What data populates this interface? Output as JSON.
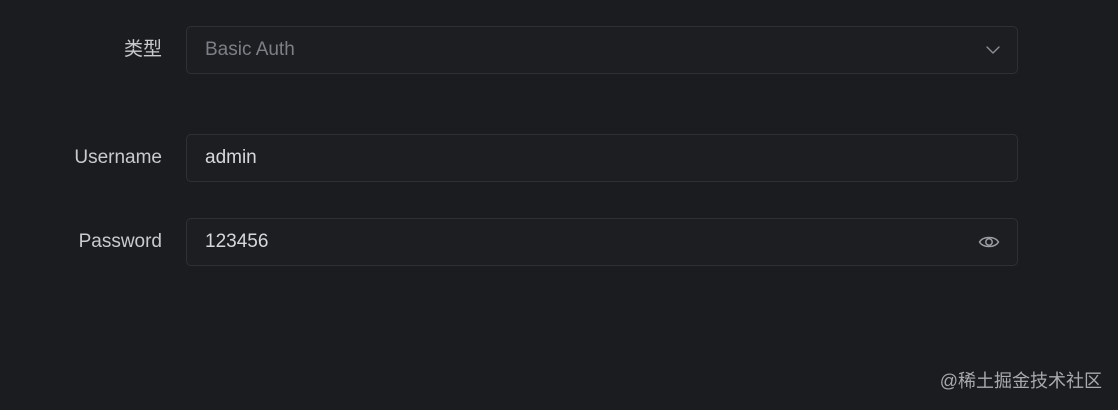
{
  "auth_type": {
    "label": "类型",
    "selected_value": "Basic Auth"
  },
  "username": {
    "label": "Username",
    "value": "admin"
  },
  "password": {
    "label": "Password",
    "value": "123456"
  },
  "watermark": {
    "text": "@稀土掘金技术社区"
  },
  "icons": {
    "select_dropdown": "chevron-down-icon",
    "password_toggle": "eye-icon"
  }
}
